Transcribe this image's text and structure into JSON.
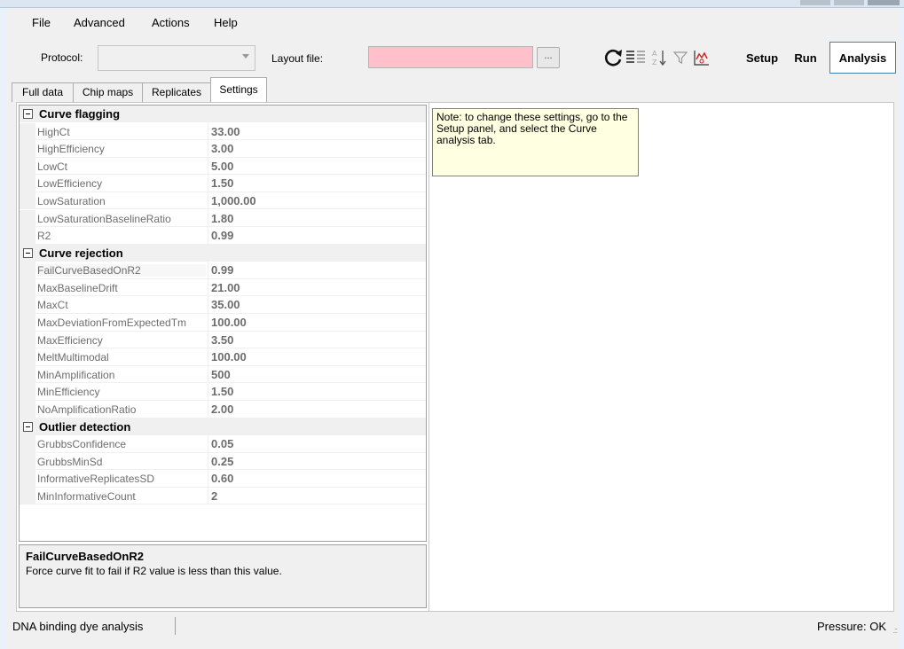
{
  "menu": {
    "items": [
      "File",
      "Advanced",
      "Actions",
      "Help"
    ]
  },
  "toolbar": {
    "protocol_label": "Protocol:",
    "protocol_value": "",
    "layout_label": "Layout file:",
    "layout_value": "",
    "browse_label": "...",
    "icons": [
      "refresh-icon",
      "list-view-icon",
      "sort-az-icon",
      "filter-icon",
      "chart-icon"
    ],
    "setup_label": "Setup",
    "run_label": "Run",
    "analysis_label": "Analysis"
  },
  "tabs": [
    "Full data",
    "Chip maps",
    "Replicates",
    "Settings"
  ],
  "selected_tab": "Settings",
  "property_grid": {
    "categories": [
      {
        "name": "Curve flagging",
        "properties": [
          {
            "name": "HighCt",
            "value": "33.00"
          },
          {
            "name": "HighEfficiency",
            "value": "3.00"
          },
          {
            "name": "LowCt",
            "value": "5.00"
          },
          {
            "name": "LowEfficiency",
            "value": "1.50"
          },
          {
            "name": "LowSaturation",
            "value": "1,000.00"
          },
          {
            "name": "LowSaturationBaselineRatio",
            "value": "1.80"
          },
          {
            "name": "R2",
            "value": "0.99"
          }
        ]
      },
      {
        "name": "Curve rejection",
        "properties": [
          {
            "name": "FailCurveBasedOnR2",
            "value": "0.99"
          },
          {
            "name": "MaxBaselineDrift",
            "value": "21.00"
          },
          {
            "name": "MaxCt",
            "value": "35.00"
          },
          {
            "name": "MaxDeviationFromExpectedTm",
            "value": "100.00"
          },
          {
            "name": "MaxEfficiency",
            "value": "3.50"
          },
          {
            "name": "MeltMultimodal",
            "value": "100.00"
          },
          {
            "name": "MinAmplification",
            "value": "500"
          },
          {
            "name": "MinEfficiency",
            "value": "1.50"
          },
          {
            "name": "NoAmplificationRatio",
            "value": "2.00"
          }
        ]
      },
      {
        "name": "Outlier detection",
        "properties": [
          {
            "name": "GrubbsConfidence",
            "value": "0.05"
          },
          {
            "name": "GrubbsMinSd",
            "value": "0.25"
          },
          {
            "name": "InformativeReplicatesSD",
            "value": "0.60"
          },
          {
            "name": "MinInformativeCount",
            "value": "2"
          }
        ]
      }
    ],
    "selected_property": "FailCurveBasedOnR2"
  },
  "help": {
    "title": "FailCurveBasedOnR2",
    "description": "Force curve fit to fail if R2 value is less than this value."
  },
  "note": {
    "text": "Note: to change these settings, go to the Setup panel, and select the Curve analysis tab."
  },
  "status": {
    "left": "DNA binding dye analysis",
    "right": "Pressure: OK"
  },
  "colors": {
    "layout_field_bg": "#ffc0cb",
    "note_bg": "#ffffe1",
    "active_button_border": "#3c7fb1",
    "property_name": "#6d6d6d"
  }
}
